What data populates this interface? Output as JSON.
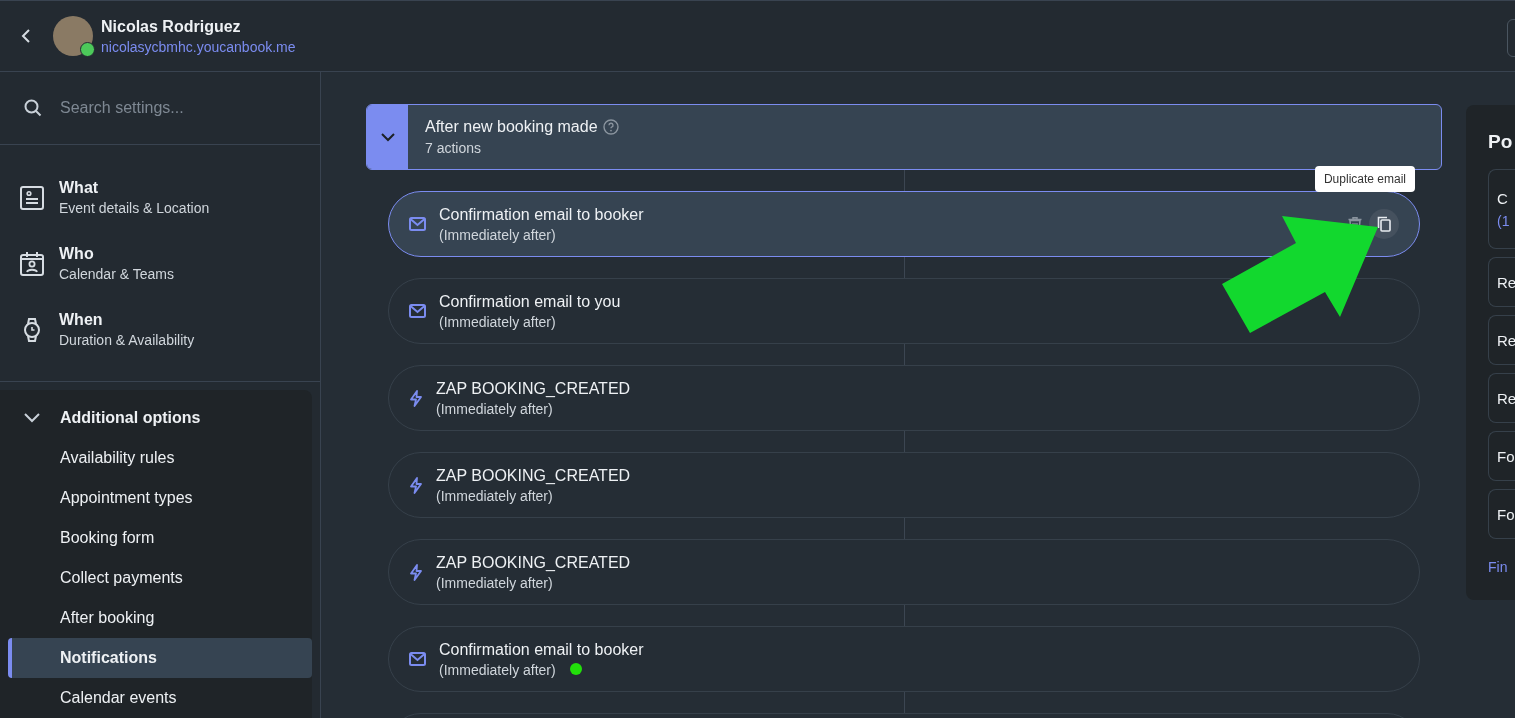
{
  "header": {
    "name": "Nicolas Rodriguez",
    "url": "nicolasycbmhc.youcanbook.me",
    "online": true
  },
  "sidebar": {
    "search": {
      "placeholder": "Search settings..."
    },
    "sections": [
      {
        "kind": "what",
        "title": "What",
        "subtitle": "Event details & Location"
      },
      {
        "kind": "who",
        "title": "Who",
        "subtitle": "Calendar & Teams"
      },
      {
        "kind": "when",
        "title": "When",
        "subtitle": "Duration & Availability"
      }
    ],
    "additional": {
      "title": "Additional options",
      "expanded": true,
      "items": [
        {
          "label": "Availability rules",
          "selected": false
        },
        {
          "label": "Appointment types",
          "selected": false
        },
        {
          "label": "Booking form",
          "selected": false
        },
        {
          "label": "Collect payments",
          "selected": false
        },
        {
          "label": "After booking",
          "selected": false
        },
        {
          "label": "Notifications",
          "selected": true
        },
        {
          "label": "Calendar events",
          "selected": false
        }
      ]
    }
  },
  "group": {
    "title": "After new booking made",
    "count": "7 actions",
    "expanded": true,
    "actions": [
      {
        "kind": "email",
        "title": "Confirmation email to booker",
        "timing": "(Immediately after)",
        "selected": true,
        "tooltip": "Duplicate email"
      },
      {
        "kind": "email",
        "title": "Confirmation email to you",
        "timing": "(Immediately after)",
        "selected": false
      },
      {
        "kind": "zap",
        "title": "ZAP BOOKING_CREATED",
        "timing": "(Immediately after)",
        "selected": false
      },
      {
        "kind": "zap",
        "title": "ZAP BOOKING_CREATED",
        "timing": "(Immediately after)",
        "selected": false
      },
      {
        "kind": "zap",
        "title": "ZAP BOOKING_CREATED",
        "timing": "(Immediately after)",
        "selected": false
      },
      {
        "kind": "email",
        "title": "Confirmation email to booker",
        "timing": "(Immediately after)",
        "selected": false
      }
    ]
  },
  "side_panel": {
    "title": "Po",
    "cards": [
      {
        "title": "C",
        "note": "(1"
      },
      {
        "title": "Re"
      },
      {
        "title": "Re"
      },
      {
        "title": "Re"
      },
      {
        "title": "Fo"
      },
      {
        "title": "Fo"
      }
    ],
    "link": "Fin"
  }
}
